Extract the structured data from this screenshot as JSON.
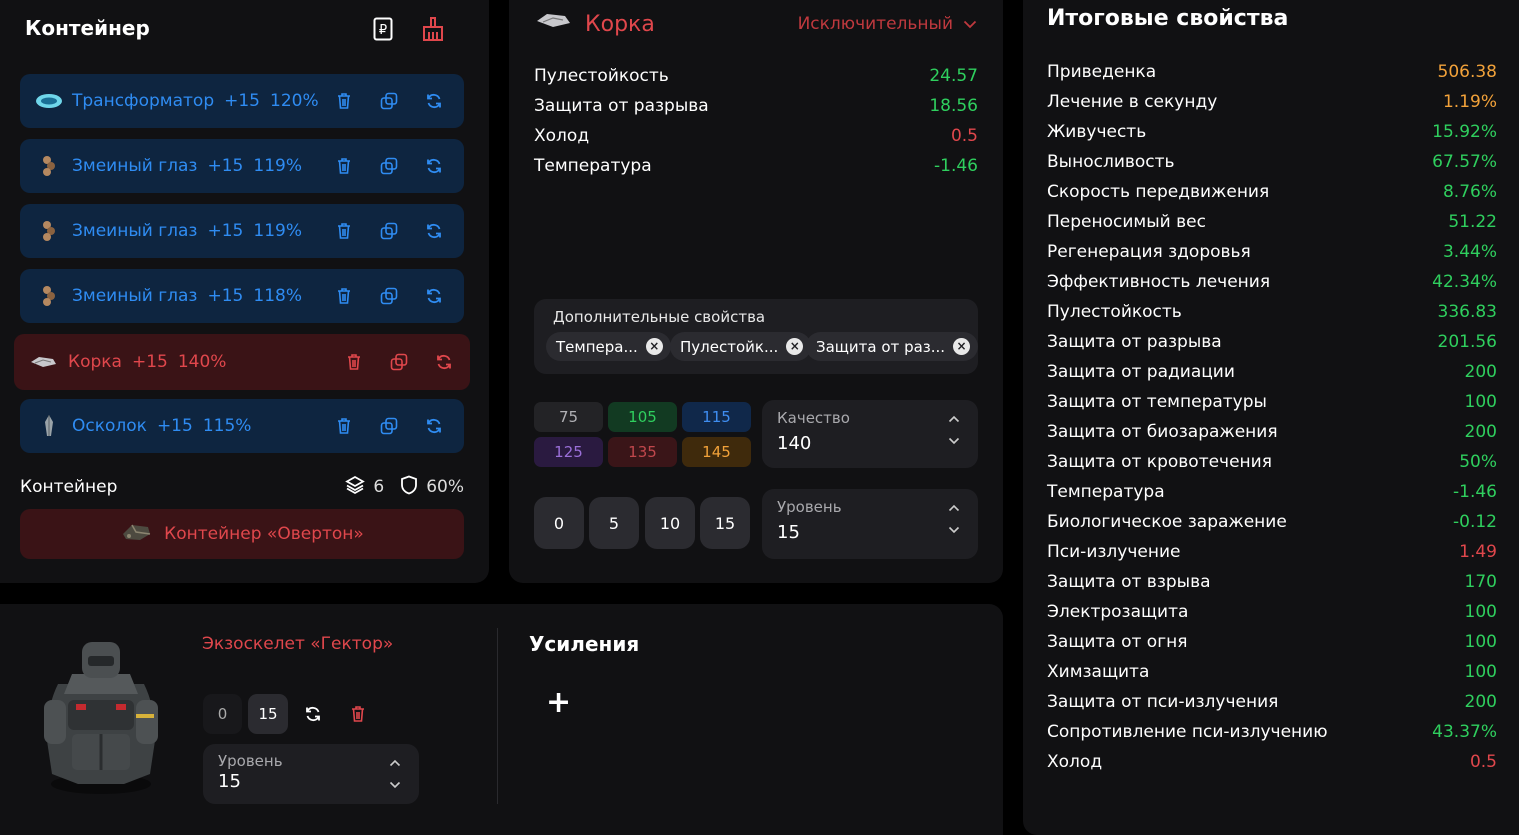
{
  "container": {
    "title": "Контейнер",
    "artifacts": [
      {
        "name": "Трансформатор",
        "level": "+15",
        "percent": "120%",
        "color": "blue",
        "icon": "transformer-artifact-icon"
      },
      {
        "name": "Змеиный глаз",
        "level": "+15",
        "percent": "119%",
        "color": "blue",
        "icon": "snake-eye-artifact-icon"
      },
      {
        "name": "Змеиный глаз",
        "level": "+15",
        "percent": "119%",
        "color": "blue",
        "icon": "snake-eye-artifact-icon"
      },
      {
        "name": "Змеиный глаз",
        "level": "+15",
        "percent": "118%",
        "color": "blue",
        "icon": "snake-eye-artifact-icon"
      },
      {
        "name": "Корка",
        "level": "+15",
        "percent": "140%",
        "color": "red",
        "icon": "crust-artifact-icon"
      },
      {
        "name": "Осколок",
        "level": "+15",
        "percent": "115%",
        "color": "blue",
        "icon": "shard-artifact-icon"
      }
    ],
    "footer_label": "Контейнер",
    "slots": "6",
    "protection": "60%",
    "container_name": "Контейнер «Овертон»"
  },
  "artifact": {
    "name": "Корка",
    "rarity": "Исключительный",
    "properties": [
      {
        "label": "Пулестойкость",
        "value": "24.57",
        "color": "green"
      },
      {
        "label": "Защита от разрыва",
        "value": "18.56",
        "color": "green"
      },
      {
        "label": "Холод",
        "value": "0.5",
        "color": "red"
      },
      {
        "label": "Температура",
        "value": "-1.46",
        "color": "green"
      }
    ],
    "extra_label": "Дополнительные свойства",
    "chips": [
      "Темпера...",
      "Пулестойк...",
      "Защита от раз..."
    ],
    "quality_presets": [
      "75",
      "105",
      "115",
      "125",
      "135",
      "145"
    ],
    "quality_label": "Качество",
    "quality_value": "140",
    "level_presets": [
      "0",
      "5",
      "10",
      "15"
    ],
    "level_label": "Уровень",
    "level_value": "15"
  },
  "totals": {
    "title": "Итоговые свойства",
    "rows": [
      {
        "label": "Приведенка",
        "value": "506.38",
        "color": "orange"
      },
      {
        "label": "Лечение в секунду",
        "value": "1.19%",
        "color": "orange"
      },
      {
        "label": "Живучесть",
        "value": "15.92%",
        "color": "green"
      },
      {
        "label": "Выносливость",
        "value": "67.57%",
        "color": "green"
      },
      {
        "label": "Скорость передвижения",
        "value": "8.76%",
        "color": "green"
      },
      {
        "label": "Переносимый вес",
        "value": "51.22",
        "color": "green"
      },
      {
        "label": "Регенерация здоровья",
        "value": "3.44%",
        "color": "green"
      },
      {
        "label": "Эффективность лечения",
        "value": "42.34%",
        "color": "green"
      },
      {
        "label": "Пулестойкость",
        "value": "336.83",
        "color": "green"
      },
      {
        "label": "Защита от разрыва",
        "value": "201.56",
        "color": "green"
      },
      {
        "label": "Защита от радиации",
        "value": "200",
        "color": "green"
      },
      {
        "label": "Защита от температуры",
        "value": "100",
        "color": "green"
      },
      {
        "label": "Защита от биозаражения",
        "value": "200",
        "color": "green"
      },
      {
        "label": "Защита от кровотечения",
        "value": "50%",
        "color": "green"
      },
      {
        "label": "Температура",
        "value": "-1.46",
        "color": "green"
      },
      {
        "label": "Биологическое заражение",
        "value": "-0.12",
        "color": "green"
      },
      {
        "label": "Пси-излучение",
        "value": "1.49",
        "color": "red"
      },
      {
        "label": "Защита от взрыва",
        "value": "170",
        "color": "green"
      },
      {
        "label": "Электрозащита",
        "value": "100",
        "color": "green"
      },
      {
        "label": "Защита от огня",
        "value": "100",
        "color": "green"
      },
      {
        "label": "Химзащита",
        "value": "100",
        "color": "green"
      },
      {
        "label": "Защита от пси-излучения",
        "value": "200",
        "color": "green"
      },
      {
        "label": "Сопротивление пси-излучению",
        "value": "43.37%",
        "color": "green"
      },
      {
        "label": "Холод",
        "value": "0.5",
        "color": "red"
      }
    ]
  },
  "armor": {
    "name": "Экзоскелет «Гектор»",
    "level_min": "0",
    "level_max": "15",
    "level_label": "Уровень",
    "level_value": "15",
    "boosts_title": "Усиления",
    "add_label": "+"
  },
  "colors": {
    "green": "#2fcf5e",
    "red": "#e0474c",
    "orange": "#f2a23a",
    "blue": "#2f8cf2",
    "panel": "#111113"
  }
}
